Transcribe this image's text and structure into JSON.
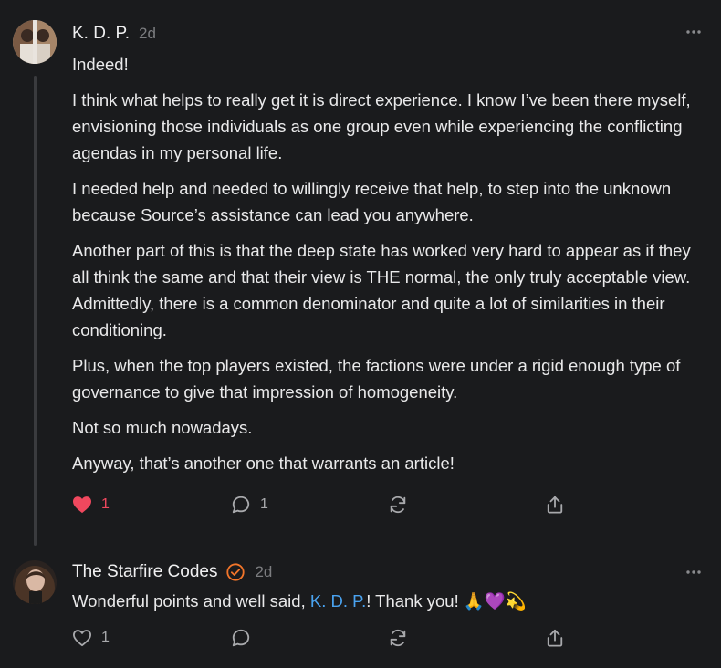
{
  "comments": [
    {
      "author": "K. D. P.",
      "time": "2d",
      "paragraphs": [
        "Indeed!",
        "I think what helps to really get it is direct experience. I know I’ve been there myself, envisioning those individuals as one group even while experiencing the conflicting agendas in my personal life.",
        "I needed help and needed to willingly receive that help, to step into the unknown because Source’s assistance can lead you anywhere.",
        "Another part of this is that the deep state has worked very hard to appear as if they all think the same and that their view is THE normal, the only truly acceptable view. Admittedly, there is a common denominator and quite a lot of similarities in their conditioning.",
        "Plus, when the top players existed, the factions were under a rigid enough type of governance to give that impression of homogeneity.",
        "Not so much nowadays.",
        "Anyway, that’s another one that warrants an article!"
      ],
      "likes": "1",
      "liked": true,
      "replies": "1",
      "more_icon": "more-horizontal-icon"
    },
    {
      "author": "The Starfire Codes",
      "time": "2d",
      "badge_icon": "verified-check-icon",
      "text_before": "Wonderful points and well said, ",
      "mention": "K. D. P.",
      "text_after": "! Thank you! 🙏💜💫",
      "likes": "1",
      "liked": false,
      "more_icon": "more-horizontal-icon"
    }
  ],
  "colors": {
    "background": "#1a1b1d",
    "like_active": "#f0485e",
    "mention": "#4aa3f0",
    "badge": "#f2752a",
    "muted": "#7c7d80"
  }
}
